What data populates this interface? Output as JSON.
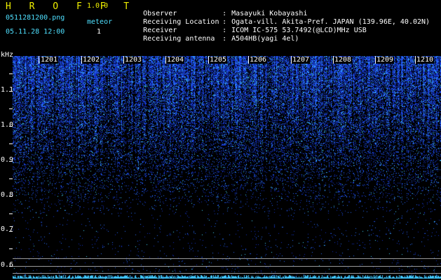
{
  "app": {
    "title": "H R O F F T",
    "version": "1.0.0",
    "filename": "0511281200.png",
    "datetime": "05.11.28 12:00",
    "meteor_label": "meteor",
    "meteor_count": "1"
  },
  "station": [
    {
      "key": "Observer",
      "value": "Masayuki Kobayashi"
    },
    {
      "key": "Receiving Location",
      "value": "Ogata-vill. Akita-Pref. JAPAN (139.96E, 40.02N)"
    },
    {
      "key": "Receiver",
      "value": "ICOM IC-575 53.7492(@LCD)MHz USB"
    },
    {
      "key": "Receiving antenna",
      "value": "A504HB(yagi 4el)"
    }
  ],
  "separator": ":",
  "axes": {
    "y_unit": "kHz",
    "y_ticks": [
      "1.1",
      "1.0",
      "0.9",
      "0.8",
      "0.7",
      "0.6"
    ],
    "x_ticks": [
      "1201",
      "1202",
      "1203",
      "1204",
      "1205",
      "1206",
      "1207",
      "1208",
      "1209",
      "1210"
    ]
  },
  "colors": {
    "background": "#000000",
    "noise_blue": "#3060ff",
    "noise_cyan": "#40d0ff",
    "header_yellow": "#f0f000",
    "header_cyan": "#4fe0ff"
  }
}
